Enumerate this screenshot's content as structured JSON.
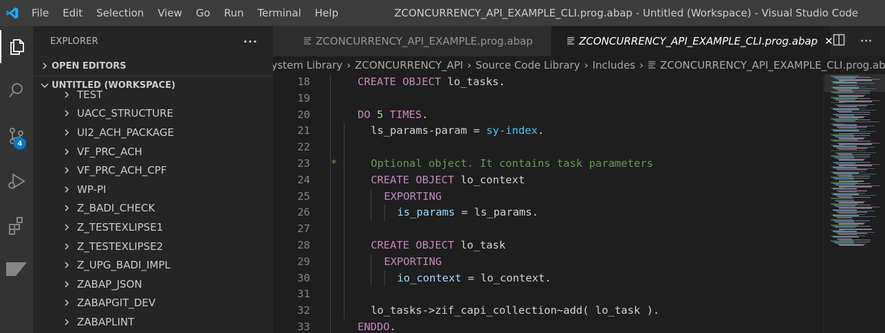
{
  "titlebar": {
    "menu": [
      "File",
      "Edit",
      "Selection",
      "View",
      "Go",
      "Run",
      "Terminal",
      "Help"
    ],
    "window_title": "ZCONCURRENCY_API_EXAMPLE_CLI.prog.abap - Untitled (Workspace) - Visual Studio Code"
  },
  "activitybar": {
    "items": [
      "explorer-icon",
      "search-icon",
      "source-control-icon",
      "run-debug-icon",
      "extensions-icon",
      "abap-icon"
    ],
    "scm_badge": "4"
  },
  "sidebar": {
    "title": "EXPLORER",
    "more": "···",
    "open_editors": "OPEN EDITORS",
    "workspace": "UNTITLED (WORKSPACE)",
    "folders": [
      "TEST",
      "UACC_STRUCTURE",
      "UI2_ACH_PACKAGE",
      "VF_PRC_ACH",
      "VF_PRC_ACH_CPF",
      "WP-PI",
      "Z_BADI_CHECK",
      "Z_TESTEXLIPSE1",
      "Z_TESTEXLIPSE2",
      "Z_UPG_BADI_IMPL",
      "ZABAP_JSON",
      "ZABAPGIT_DEV",
      "ZABAPLINT"
    ]
  },
  "tabs": [
    {
      "label": "ZCONCURRENCY_API_EXAMPLE.prog.abap",
      "active": false
    },
    {
      "label": "ZCONCURRENCY_API_EXAMPLE_CLI.prog.abap",
      "active": true
    }
  ],
  "breadcrumb": [
    "System Library",
    "ZCONCURRENCY_API",
    "Source Code Library",
    "Includes",
    "ZCONCURRENCY_API_EXAMPLE_CLI.prog.abap"
  ],
  "editor": {
    "lines": [
      {
        "n": "18",
        "indent": 0,
        "tokens": [
          [
            "kw",
            "CREATE OBJECT"
          ],
          [
            "id",
            " lo_tasks."
          ]
        ]
      },
      {
        "n": "19",
        "indent": 0,
        "tokens": []
      },
      {
        "n": "20",
        "indent": 0,
        "tokens": [
          [
            "kw",
            "DO"
          ],
          [
            "num",
            " 5"
          ],
          [
            "kw",
            " TIMES"
          ],
          [
            "id",
            "."
          ]
        ]
      },
      {
        "n": "21",
        "indent": 1,
        "tokens": [
          [
            "id",
            "ls_params-param = "
          ],
          [
            "blue",
            "sy-index"
          ],
          [
            "id",
            "."
          ]
        ]
      },
      {
        "n": "22",
        "indent": 0,
        "tokens": []
      },
      {
        "n": "23",
        "indent": 1,
        "marker": "*",
        "tokens": [
          [
            "com",
            "Optional object. It contains task parameters"
          ]
        ]
      },
      {
        "n": "24",
        "indent": 1,
        "tokens": [
          [
            "kw",
            "CREATE OBJECT"
          ],
          [
            "id",
            " lo_context"
          ]
        ]
      },
      {
        "n": "25",
        "indent": 2,
        "tokens": [
          [
            "kw",
            "EXPORTING"
          ]
        ]
      },
      {
        "n": "26",
        "indent": 3,
        "tokens": [
          [
            "fld",
            "is_params"
          ],
          [
            "id",
            " = ls_params."
          ]
        ]
      },
      {
        "n": "27",
        "indent": 0,
        "tokens": []
      },
      {
        "n": "28",
        "indent": 1,
        "tokens": [
          [
            "kw",
            "CREATE OBJECT"
          ],
          [
            "id",
            " lo_task"
          ]
        ]
      },
      {
        "n": "29",
        "indent": 2,
        "tokens": [
          [
            "kw",
            "EXPORTING"
          ]
        ]
      },
      {
        "n": "30",
        "indent": 3,
        "tokens": [
          [
            "fld",
            "io_context"
          ],
          [
            "id",
            " = lo_context."
          ]
        ]
      },
      {
        "n": "31",
        "indent": 0,
        "tokens": []
      },
      {
        "n": "32",
        "indent": 1,
        "tokens": [
          [
            "id",
            "lo_tasks->zif_capi_collection~add( lo_task )."
          ]
        ]
      },
      {
        "n": "33",
        "indent": 0,
        "tokens": [
          [
            "kw",
            "ENDDO"
          ],
          [
            "id",
            "."
          ]
        ]
      }
    ]
  },
  "colors": {
    "accent": "#007acc",
    "keyword": "#c586c0",
    "comment": "#6a9955",
    "number": "#b5cea8",
    "field": "#9cdcfe"
  }
}
